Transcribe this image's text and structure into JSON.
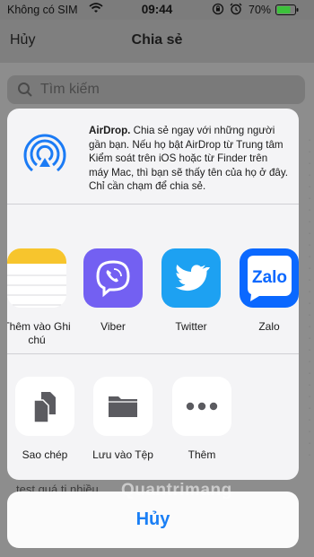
{
  "status": {
    "carrier": "Không có SIM",
    "time": "09:44",
    "battery": "70%",
    "icons": [
      "wifi-icon",
      "orientation-lock-icon",
      "alarm-icon",
      "battery-icon"
    ]
  },
  "background": {
    "cancel": "Hủy",
    "title": "Chia sẻ",
    "search_placeholder": "Tìm kiếm",
    "partial_row": "test quá ti nhiều"
  },
  "airdrop": {
    "title": "AirDrop.",
    "description": " Chia sẻ ngay với những người gần bạn. Nếu họ bật AirDrop từ Trung tâm Kiểm soát trên iOS hoặc từ Finder trên máy Mac, thì bạn sẽ thấy tên của họ ở đây. Chỉ cần chạm để chia sẻ."
  },
  "apps": [
    {
      "label": "Thêm vào Ghi chú",
      "icon": "notes-icon",
      "color": "#ffffff"
    },
    {
      "label": "Viber",
      "icon": "viber-icon",
      "color": "#7360f2"
    },
    {
      "label": "Twitter",
      "icon": "twitter-icon",
      "color": "#1da1f2"
    },
    {
      "label": "Zalo",
      "icon": "zalo-icon",
      "color": "#0a68ff"
    }
  ],
  "actions": [
    {
      "label": "Sao chép",
      "icon": "copy-icon"
    },
    {
      "label": "Lưu vào Tệp",
      "icon": "folder-icon"
    },
    {
      "label": "Thêm",
      "icon": "more-icon"
    }
  ],
  "cancel_button": "Hủy",
  "watermark": "Quantrimang",
  "colors": {
    "accent": "#1a7ff5",
    "sheet": "#f4f4f6"
  }
}
